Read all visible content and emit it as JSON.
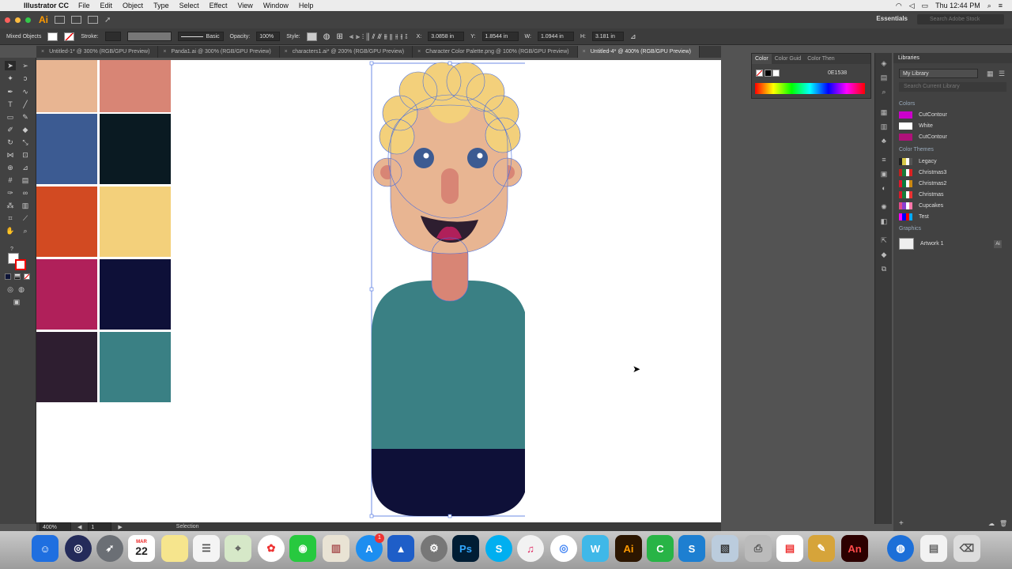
{
  "menubar": {
    "app_name": "Illustrator CC",
    "items": [
      "File",
      "Edit",
      "Object",
      "Type",
      "Select",
      "Effect",
      "View",
      "Window",
      "Help"
    ],
    "clock": "Thu 12:44 PM"
  },
  "appbar": {
    "logo": "Ai",
    "workspace": "Essentials",
    "search_placeholder": "Search Adobe Stock"
  },
  "controlbar": {
    "selection_type": "Mixed Objects",
    "stroke_label": "Stroke:",
    "brush_label": "Basic",
    "opacity_label": "Opacity:",
    "opacity_value": "100%",
    "style_label": "Style:",
    "x_label": "X:",
    "x_value": "3.0858 in",
    "y_label": "Y:",
    "y_value": "1.8544 in",
    "w_label": "W:",
    "w_value": "1.0944 in",
    "h_label": "H:",
    "h_value": "3.181 in"
  },
  "tabs": [
    {
      "label": "Untitled-1* @ 300% (RGB/GPU Preview)"
    },
    {
      "label": "Panda1.ai @ 300% (RGB/GPU Preview)"
    },
    {
      "label": "characters1.ai* @ 200% (RGB/GPU Preview)"
    },
    {
      "label": "Character Color Palette.png @ 100% (RGB/GPU Preview)"
    },
    {
      "label": "Untitled-4* @ 400% (RGB/GPU Preview)"
    }
  ],
  "statusbar": {
    "zoom": "400%",
    "artboard": "1",
    "tool": "Selection"
  },
  "color_panel": {
    "tabs": [
      "Color",
      "Color Guid",
      "Color Then"
    ],
    "hex": "0E1538"
  },
  "libraries": {
    "title": "Libraries",
    "selected_library": "My Library",
    "search_placeholder": "Search Current Library",
    "colors_header": "Colors",
    "colors": [
      {
        "name": "CutContour",
        "color": "#cc00cc"
      },
      {
        "name": "White",
        "color": "#ffffff"
      },
      {
        "name": "CutContour",
        "color": "#b0127a"
      }
    ],
    "themes_header": "Color Themes",
    "themes": [
      {
        "name": "Legacy",
        "colors": [
          "#222",
          "#d8c94a",
          "#fff",
          "#555"
        ]
      },
      {
        "name": "Christmas3",
        "colors": [
          "#c0211e",
          "#1a7a3a",
          "#fff",
          "#d22"
        ]
      },
      {
        "name": "Christmas2",
        "colors": [
          "#e0182c",
          "#0b7b3e",
          "#fff",
          "#c81"
        ]
      },
      {
        "name": "Christmas",
        "colors": [
          "#d81a2a",
          "#167c3a",
          "#fff",
          "#e33"
        ]
      },
      {
        "name": "Cupcakes",
        "colors": [
          "#e34a8a",
          "#8a3fd0",
          "#fff",
          "#f7a"
        ]
      },
      {
        "name": "Test",
        "colors": [
          "#ff00ff",
          "#0000ff",
          "#ff0000",
          "#00aaff"
        ]
      }
    ],
    "graphics_header": "Graphics",
    "graphics": [
      {
        "name": "Artwork 1",
        "badge": "Ai"
      }
    ]
  },
  "palette": {
    "colors": [
      "#e8b592",
      "#d88575",
      "#3c5b92",
      "#0a1a22",
      "#d24a22",
      "#f3d07b",
      "#b0205a",
      "#0e1038",
      "#2e1e30",
      "#3a8084"
    ]
  },
  "character": {
    "skin": "#e8b592",
    "hair": "#f3d07b",
    "cheek": "#d88575",
    "eye": "#3c5b92",
    "mouth": "#2e1e30",
    "tongue": "#b0205a",
    "shirt": "#3a8084",
    "pants": "#0e1038"
  },
  "dock": {
    "calendar_month": "MAR",
    "calendar_day": "22",
    "apps": [
      "Ps",
      "Ai",
      "An"
    ]
  }
}
